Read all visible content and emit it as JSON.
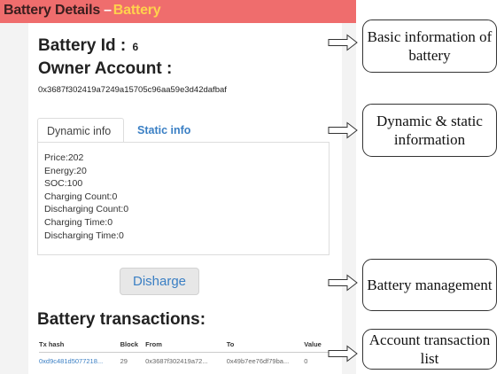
{
  "header": {
    "title": "Battery Details",
    "separator": "–",
    "accent": "Battery"
  },
  "battery": {
    "id_label": "Battery Id :",
    "id_value": "6",
    "owner_label": "Owner Account :",
    "owner_address": "0x3687f302419a7249a15705c96aa59e3d42dafbaf"
  },
  "tabs": {
    "active": "Dynamic info",
    "inactive": "Static info"
  },
  "dynamic_info": [
    "Price:202",
    "Energy:20",
    "SOC:100",
    "Charging Count:0",
    "Discharging Count:0",
    "Charging Time:0",
    "Discharging Time:0"
  ],
  "actions": {
    "discharge_label": "Disharge"
  },
  "transactions": {
    "title": "Battery transactions:",
    "columns": [
      "Tx hash",
      "Block",
      "From",
      "To",
      "Value"
    ],
    "rows": [
      [
        "0xd9c481d5077218...",
        "29",
        "0x3687f302419a72...",
        "0x49b7ee76df79ba...",
        "0"
      ]
    ]
  },
  "callouts": [
    "Basic information of battery",
    "Dynamic & static information",
    "Battery management",
    "Account transaction list"
  ],
  "colors": {
    "header_bg": "#ef6d6d",
    "header_accent": "#ffd24d",
    "link_blue": "#3a7fc4"
  }
}
